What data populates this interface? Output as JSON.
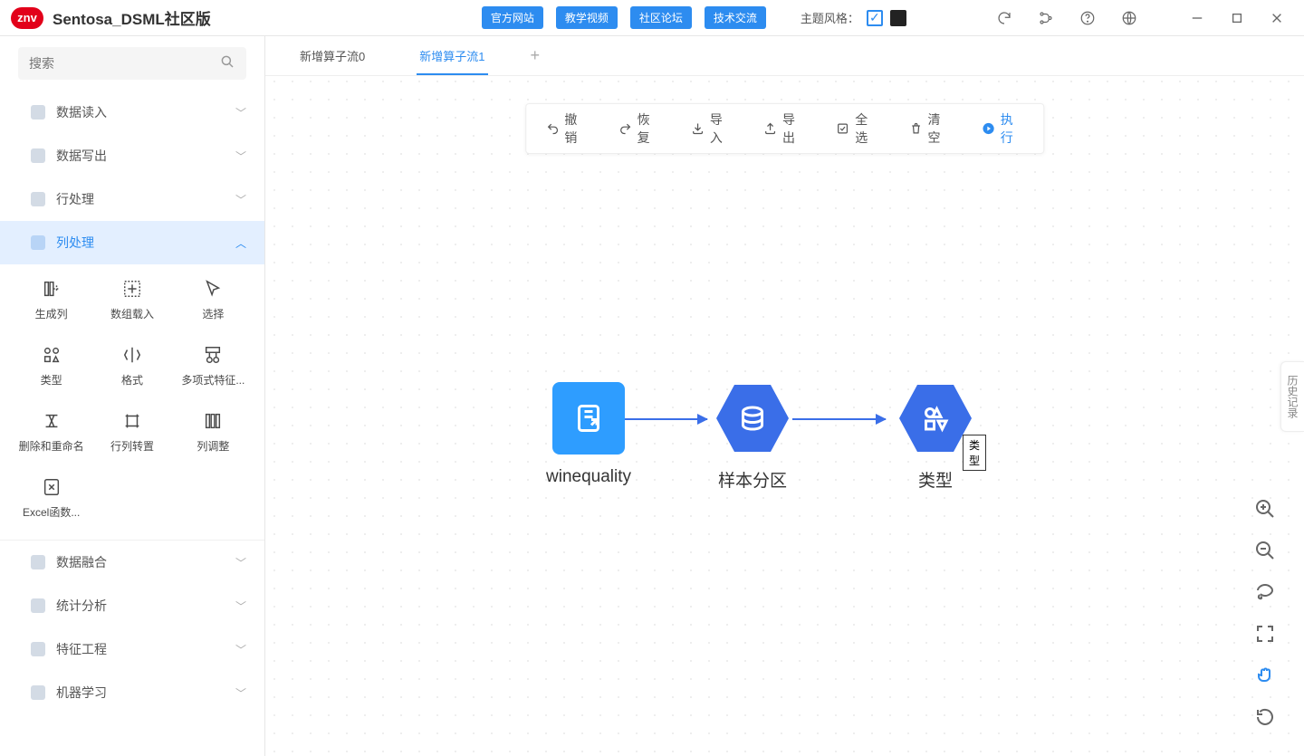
{
  "app": {
    "logo_text": "znv",
    "title": "Sentosa_DSML社区版"
  },
  "top_links": [
    "官方网站",
    "教学视频",
    "社区论坛",
    "技术交流"
  ],
  "theme": {
    "label": "主题风格："
  },
  "sidebar": {
    "search_placeholder": "搜索",
    "groups": [
      {
        "label": "数据读入",
        "active": false
      },
      {
        "label": "数据写出",
        "active": false
      },
      {
        "label": "行处理",
        "active": false
      },
      {
        "label": "列处理",
        "active": true
      },
      {
        "label": "数据融合",
        "active": false
      },
      {
        "label": "统计分析",
        "active": false
      },
      {
        "label": "特征工程",
        "active": false
      },
      {
        "label": "机器学习",
        "active": false
      }
    ],
    "col_tools": [
      "生成列",
      "数组载入",
      "选择",
      "类型",
      "格式",
      "多项式特征...",
      "删除和重命名",
      "行列转置",
      "列调整",
      "Excel函数..."
    ]
  },
  "tabs": {
    "items": [
      "新增算子流0",
      "新增算子流1"
    ],
    "active_index": 1
  },
  "actions": {
    "undo": "撤销",
    "redo": "恢复",
    "import": "导入",
    "export": "导出",
    "select_all": "全选",
    "clear": "清空",
    "run": "执行"
  },
  "nodes": {
    "n1": {
      "label": "winequality"
    },
    "n2": {
      "label": "样本分区"
    },
    "n3": {
      "label": "类型",
      "tooltip": "类型"
    }
  },
  "side_tab": "历史记录"
}
